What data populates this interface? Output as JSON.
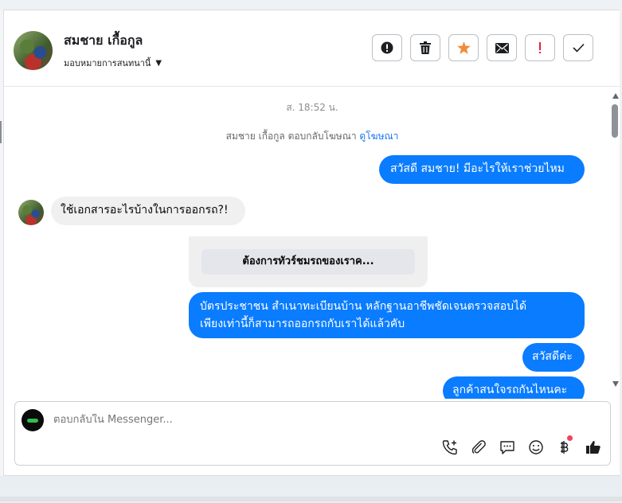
{
  "header": {
    "contact_name": "สมชาย เกื้อกูล",
    "assign_label": "มอบหมายการสนทนานี้",
    "actions": [
      {
        "name": "spam-button",
        "icon": "alert-circle-icon"
      },
      {
        "name": "delete-button",
        "icon": "trash-icon"
      },
      {
        "name": "star-button",
        "icon": "star-icon"
      },
      {
        "name": "mark-unread-button",
        "icon": "envelope-icon"
      },
      {
        "name": "priority-button",
        "icon": "exclamation-icon"
      },
      {
        "name": "mark-done-button",
        "icon": "check-icon"
      }
    ]
  },
  "conversation": {
    "timestamp": "ส. 18:52 น.",
    "ad_notice": "สมชาย เกื้อกูล ตอบกลับโฆษณา",
    "ad_link": "ดูโฆษณา",
    "messages": [
      {
        "from": "page",
        "text": "สวัสดี สมชาย! มีอะไรให้เราช่วยไหม"
      },
      {
        "from": "user",
        "text": "ใช้เอกสารอะไรบ้างในการออกรถ?!"
      },
      {
        "from": "card",
        "text": "ต้องการทัวร์ชมรถของเราค..."
      },
      {
        "from": "page",
        "line1": "บัตรประชาชน สำเนาทะเบียนบ้าน หลักฐานอาชีพชัดเจนตรวจสอบได้",
        "line2": "เพียงเท่านี้ก็สามารถออกรถกับเราได้แล้วคับ"
      },
      {
        "from": "page",
        "text": "สวัสดีค่ะ"
      },
      {
        "from": "page",
        "text": "ลูกค้าสนใจรถกันไหนคะ"
      }
    ]
  },
  "composer": {
    "placeholder": "ตอบกลับใน Messenger...",
    "icons": [
      "phone-add-icon",
      "paperclip-icon",
      "saved-replies-icon",
      "emoji-icon",
      "baht-payment-icon",
      "thumbs-up-icon"
    ]
  },
  "colors": {
    "outgoing_bubble": "#0a7cff",
    "incoming_bubble": "#f0f0f0",
    "link": "#1877f2",
    "star": "#f28c38",
    "priority": "#e41e3f"
  }
}
